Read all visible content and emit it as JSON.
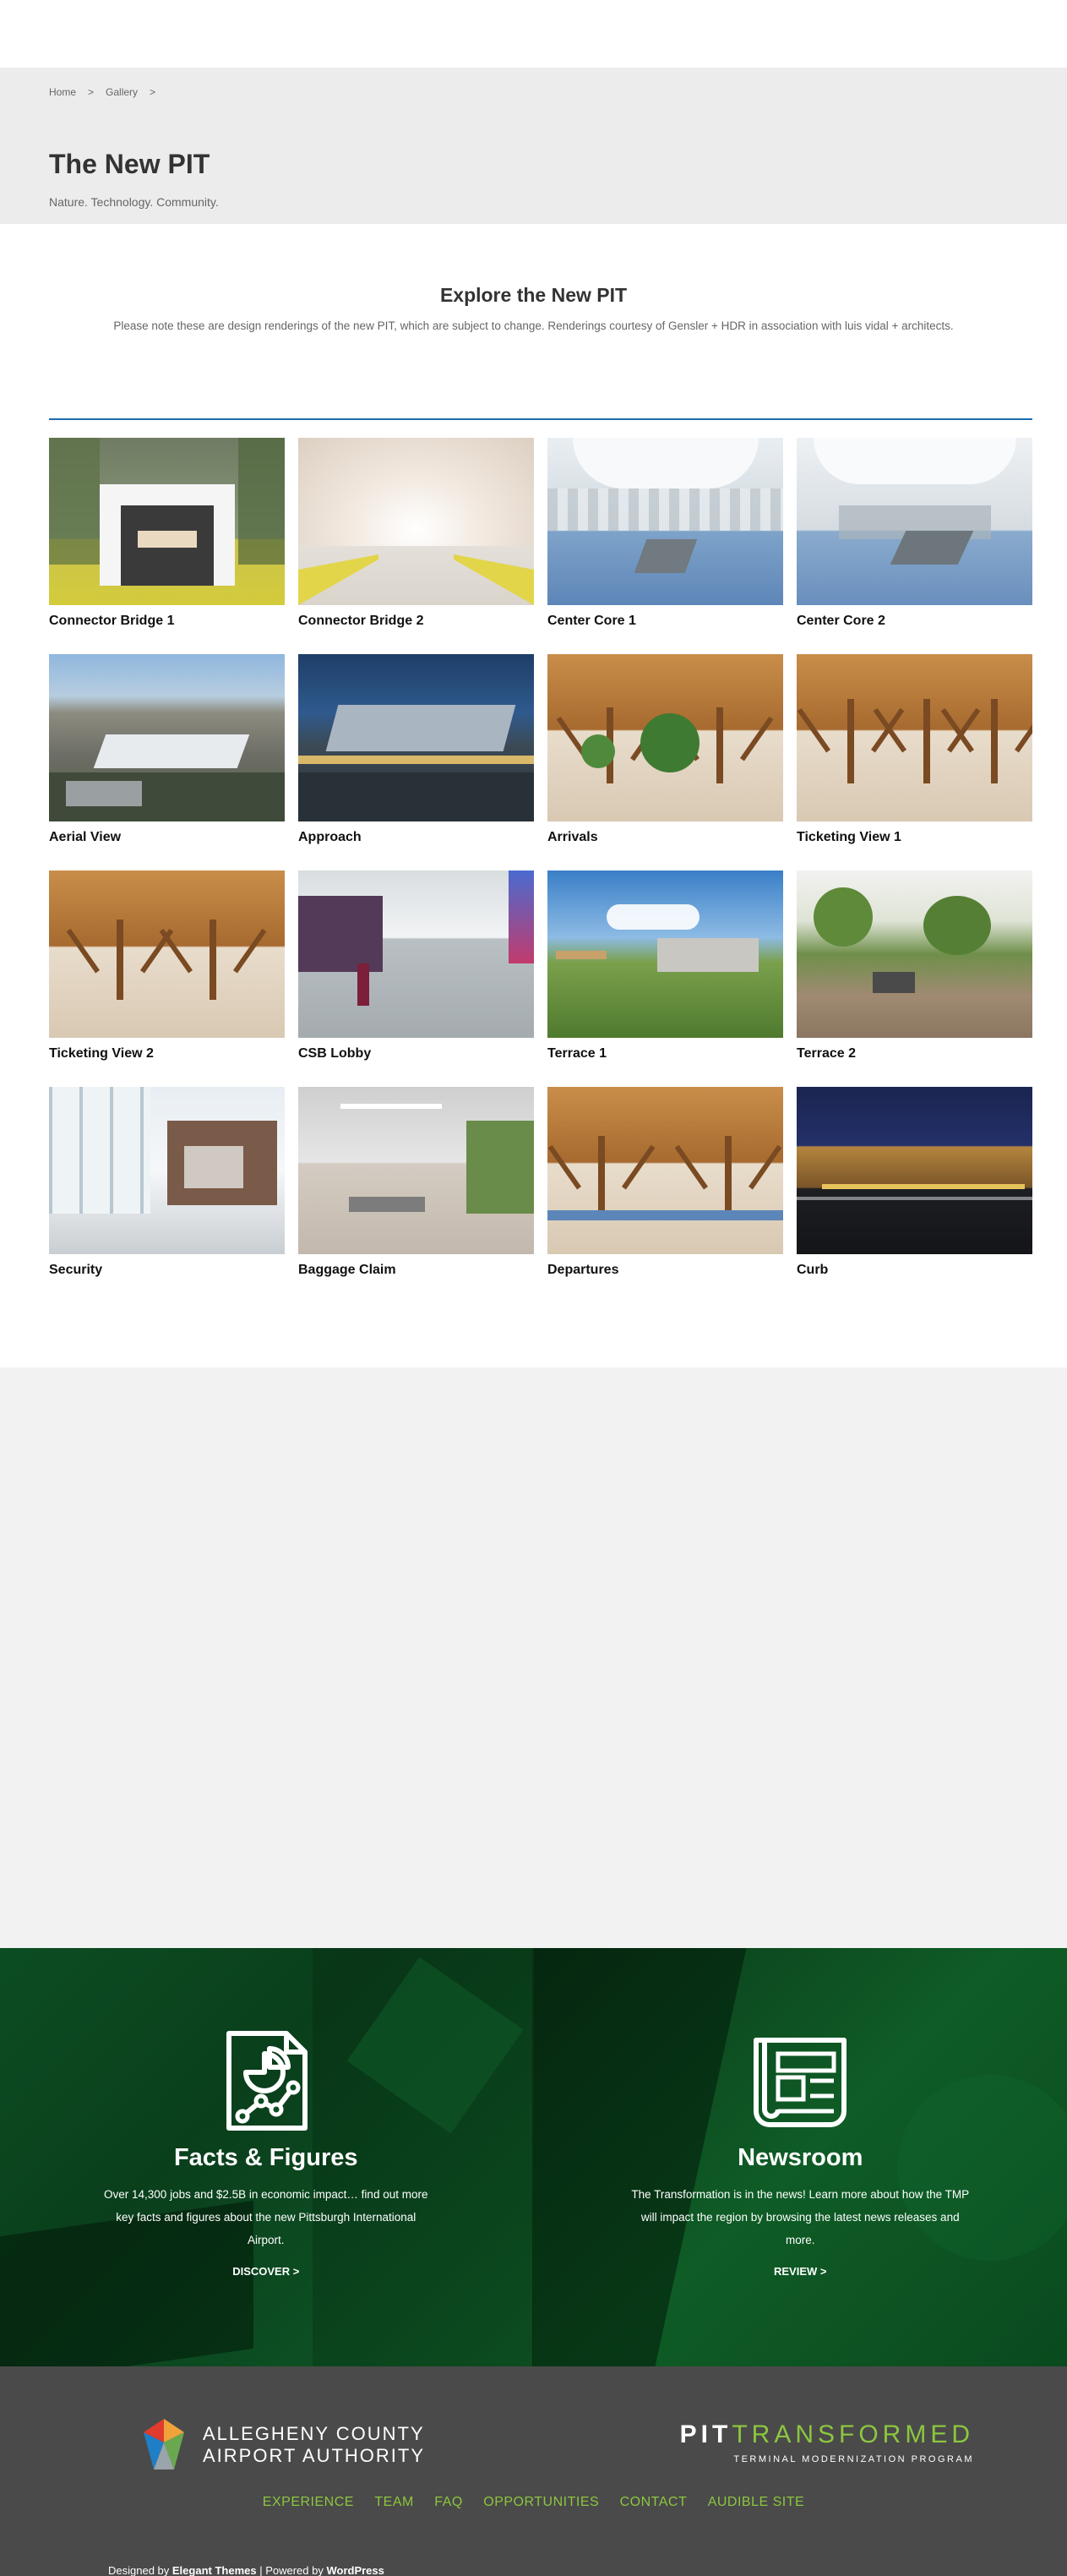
{
  "breadcrumb": {
    "home": "Home",
    "sep1": ">",
    "gallery": "Gallery",
    "sep2": ">"
  },
  "hero": {
    "title": "The New PIT",
    "tagline": "Nature. Technology. Community."
  },
  "intro": {
    "title": "Explore the New PIT",
    "note": "Please note these are design renderings of the new PIT, which are subject to change. Renderings courtesy of Gensler + HDR in association with luis vidal + architects."
  },
  "gallery": [
    {
      "caption": "Connector Bridge 1"
    },
    {
      "caption": "Connector Bridge 2"
    },
    {
      "caption": "Center Core 1"
    },
    {
      "caption": "Center Core 2"
    },
    {
      "caption": "Aerial View"
    },
    {
      "caption": "Approach"
    },
    {
      "caption": "Arrivals"
    },
    {
      "caption": "Ticketing View 1"
    },
    {
      "caption": "Ticketing View 2"
    },
    {
      "caption": "CSB Lobby"
    },
    {
      "caption": "Terrace 1"
    },
    {
      "caption": "Terrace 2"
    },
    {
      "caption": "Security"
    },
    {
      "caption": "Baggage Claim"
    },
    {
      "caption": "Departures"
    },
    {
      "caption": "Curb"
    }
  ],
  "facts": {
    "icon": "chart-document-icon",
    "title": "Facts & Figures",
    "text": "Over 14,300 jobs and $2.5B in economic impact… find out more key facts and figures about the new Pittsburgh International Airport.",
    "link": "DISCOVER >"
  },
  "newsroom": {
    "icon": "newspaper-icon",
    "title": "Newsroom",
    "text": "The Transformation is in the news! Learn more about how the TMP will impact the region by browsing the latest news releases and more.",
    "link": "REVIEW >"
  },
  "footer": {
    "aca_line1": "ALLEGHENY COUNTY",
    "aca_line2": "AIRPORT AUTHORITY",
    "pit_strong": "PIT",
    "pit_thin": "TRANSFORMED",
    "pit_sub": "TERMINAL MODERNIZATION PROGRAM",
    "nav": [
      "EXPERIENCE",
      "TEAM",
      "FAQ",
      "OPPORTUNITIES",
      "CONTACT",
      "AUDIBLE SITE"
    ],
    "credits_prefix": "Designed by ",
    "credits_brand1": "Elegant Themes",
    "credits_mid": " | Powered by ",
    "credits_brand2": "WordPress"
  },
  "colors": {
    "accent_blue": "#1a6bb0",
    "brand_green": "#8cc63f",
    "band_green": "#0c4d22",
    "footer_bg": "#4a4a4a"
  }
}
